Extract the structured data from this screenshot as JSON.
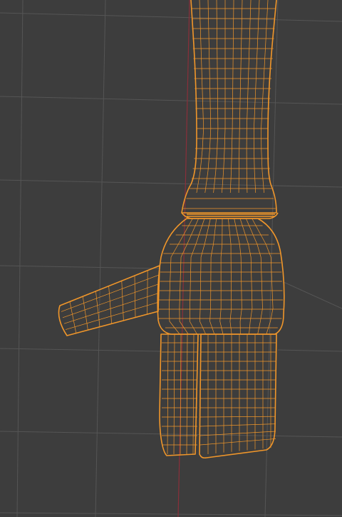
{
  "viewport": {
    "mode": "wireframe",
    "background": "#3d3d3d",
    "grid_color": "#555555",
    "axis_color": "#8a2f3a",
    "selection_color": "#f0962a"
  },
  "mesh": {
    "selected": true,
    "parts": [
      "upper-arm",
      "elbow-band",
      "forearm",
      "thumb",
      "fingers"
    ]
  }
}
